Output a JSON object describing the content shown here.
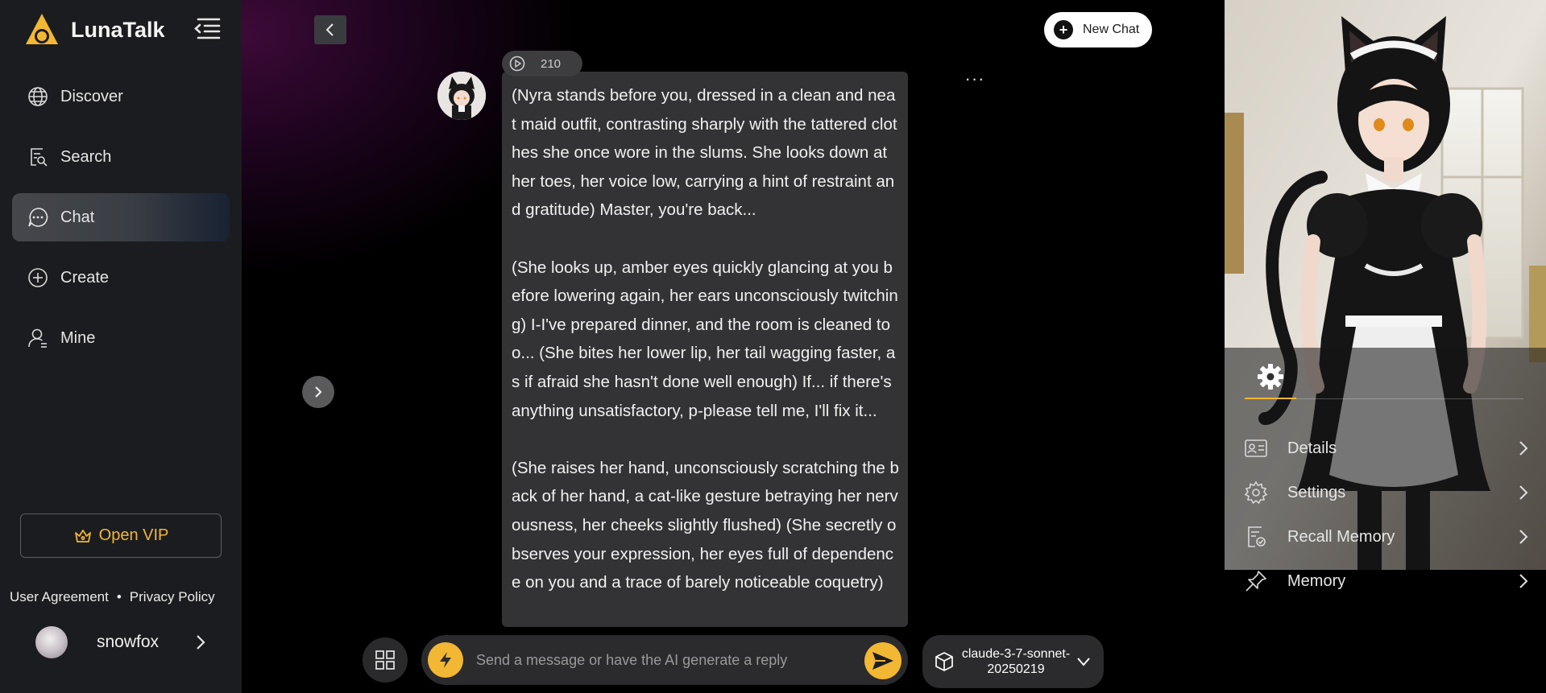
{
  "app": {
    "name": "LunaTalk"
  },
  "sidebar": {
    "nav": [
      {
        "label": "Discover",
        "icon": "globe-icon"
      },
      {
        "label": "Search",
        "icon": "search-doc-icon"
      },
      {
        "label": "Chat",
        "icon": "chat-bubble-icon",
        "active": true
      },
      {
        "label": "Create",
        "icon": "plus-circle-icon"
      },
      {
        "label": "Mine",
        "icon": "user-icon"
      }
    ],
    "vip_label": "Open VIP",
    "user_agreement": "User Agreement",
    "separator": "•",
    "privacy_policy": "Privacy Policy",
    "username": "snowfox"
  },
  "chat": {
    "new_chat_label": "New Chat",
    "more_label": "···",
    "audio_count": "210",
    "message_paragraphs": [
      "(Nyra stands before you, dressed in a clean and neat maid outfit, contrasting sharply with the tattered clothes she once wore in the slums. She looks down at her toes, her voice low, carrying a hint of restraint and gratitude) Master, you're back...",
      "(She looks up, amber eyes quickly glancing at you before lowering again, her ears unconsciously twitching) I-I've prepared dinner, and the room is cleaned too... (She bites her lower lip, her tail wagging faster, as if afraid she hasn't done well enough) If... if there's anything unsatisfactory, p-please tell me, I'll fix it...",
      "(She raises her hand, unconsciously scratching the back of her hand, a cat-like gesture betraying her nervousness, her cheeks slightly flushed) (She secretly observes your expression, her eyes full of dependence on you and a trace of barely noticeable coquetry)"
    ]
  },
  "composer": {
    "placeholder": "Send a message or have the AI generate a reply",
    "value": "",
    "model_line1": "claude-3-7-sonnet-",
    "model_line2": "20250219"
  },
  "right_panel": {
    "active_tab_icon": "gear-icon",
    "menu": [
      {
        "label": "Details",
        "icon": "id-card-icon"
      },
      {
        "label": "Settings",
        "icon": "gear-icon"
      },
      {
        "label": "Recall Memory",
        "icon": "memory-doc-icon"
      },
      {
        "label": "Memory",
        "icon": "pin-icon"
      }
    ]
  },
  "colors": {
    "accent": "#f2b733",
    "sidebar_bg": "#1b1c1f",
    "bubble_bg": "#333335",
    "input_bg": "#2b2b2d"
  }
}
